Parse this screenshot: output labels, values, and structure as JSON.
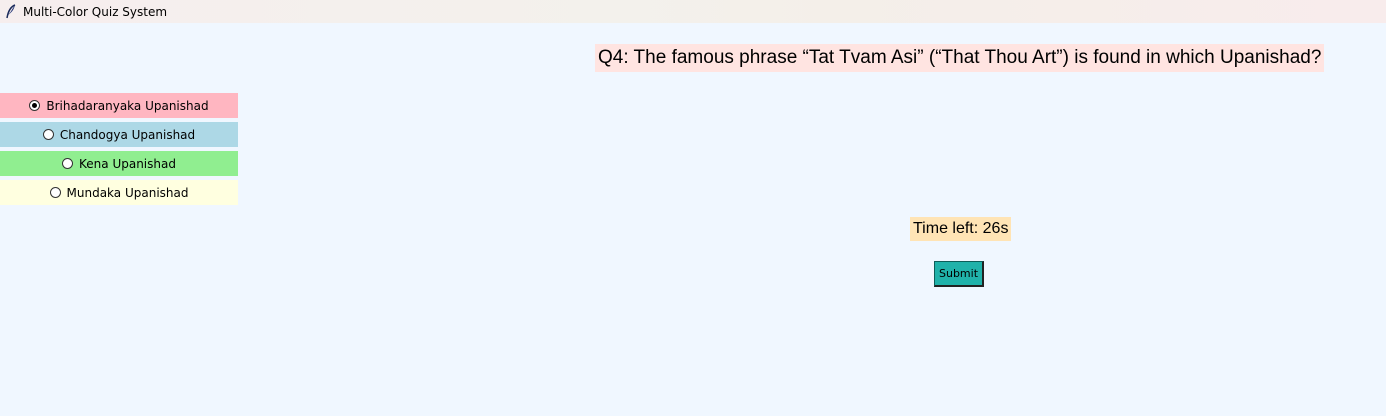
{
  "window": {
    "title": "Multi-Color Quiz System",
    "icon": "feather-icon"
  },
  "quiz": {
    "question": "Q4: The famous phrase “Tat Tvam Asi” (“That Thou Art”) is found in which Upanishad?",
    "options": [
      {
        "label": "Brihadaranyaka Upanishad",
        "selected": true,
        "color": "#ffb6c1"
      },
      {
        "label": "Chandogya Upanishad",
        "selected": false,
        "color": "#add8e6"
      },
      {
        "label": "Kena Upanishad",
        "selected": false,
        "color": "#90ee90"
      },
      {
        "label": "Mundaka Upanishad",
        "selected": false,
        "color": "#ffffe0"
      }
    ],
    "timer_text": "Time left: 26s",
    "submit_label": "Submit"
  },
  "colors": {
    "background": "#f0f7ff",
    "question_bg": "#ffe4e1",
    "timer_bg": "#ffe4b5",
    "submit_bg": "#20b2aa"
  }
}
